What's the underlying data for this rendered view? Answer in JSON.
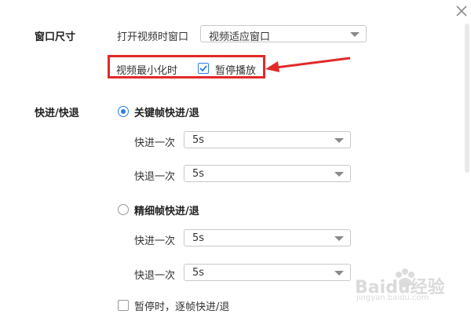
{
  "window": {
    "close_icon": "close-icon"
  },
  "window_size": {
    "label": "窗口尺寸",
    "open_label": "打开视频时窗口",
    "open_select_value": "视频适应窗口",
    "minimize_label": "视频最小化时",
    "pause_checkbox_label": "暂停播放",
    "pause_checked": true
  },
  "seek": {
    "label": "快进/快退",
    "keyframe": {
      "label": "关键帧快进/退",
      "selected": true,
      "forward_label": "快进一次",
      "forward_value": "5s",
      "back_label": "快退一次",
      "back_value": "5s"
    },
    "fine": {
      "label": "精细帧快进/退",
      "selected": false,
      "forward_label": "快进一次",
      "forward_value": "5s",
      "back_label": "快退一次",
      "back_value": "5s"
    },
    "paused_frame_label": "暂停时，逐帧快进/退",
    "paused_frame_checked": false
  },
  "annotation": {
    "color": "#e02a2a"
  },
  "watermark": {
    "brand": "Baidu经验",
    "url": "jingyan.baidu.com"
  },
  "colors": {
    "accent": "#2d7be5",
    "highlight": "#e02a2a"
  }
}
